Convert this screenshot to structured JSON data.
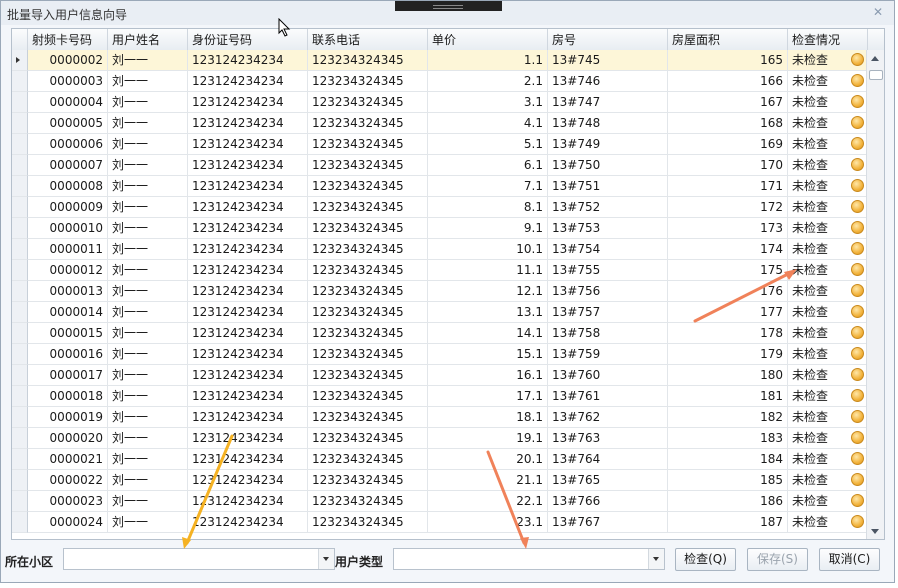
{
  "window": {
    "title": "批量导入用户信息向导"
  },
  "columns": [
    "射频卡号码",
    "用户姓名",
    "身份证号码",
    "联系电话",
    "单价",
    "房号",
    "房屋面积",
    "检查情况"
  ],
  "rows": [
    {
      "card": "0000002",
      "name": "刘一一",
      "id": "123124234234",
      "phone": "123234324345",
      "price": "1.1",
      "room": "13#745",
      "area": "165",
      "status": "未检查"
    },
    {
      "card": "0000003",
      "name": "刘一一",
      "id": "123124234234",
      "phone": "123234324345",
      "price": "2.1",
      "room": "13#746",
      "area": "166",
      "status": "未检查"
    },
    {
      "card": "0000004",
      "name": "刘一一",
      "id": "123124234234",
      "phone": "123234324345",
      "price": "3.1",
      "room": "13#747",
      "area": "167",
      "status": "未检查"
    },
    {
      "card": "0000005",
      "name": "刘一一",
      "id": "123124234234",
      "phone": "123234324345",
      "price": "4.1",
      "room": "13#748",
      "area": "168",
      "status": "未检查"
    },
    {
      "card": "0000006",
      "name": "刘一一",
      "id": "123124234234",
      "phone": "123234324345",
      "price": "5.1",
      "room": "13#749",
      "area": "169",
      "status": "未检查"
    },
    {
      "card": "0000007",
      "name": "刘一一",
      "id": "123124234234",
      "phone": "123234324345",
      "price": "6.1",
      "room": "13#750",
      "area": "170",
      "status": "未检查"
    },
    {
      "card": "0000008",
      "name": "刘一一",
      "id": "123124234234",
      "phone": "123234324345",
      "price": "7.1",
      "room": "13#751",
      "area": "171",
      "status": "未检查"
    },
    {
      "card": "0000009",
      "name": "刘一一",
      "id": "123124234234",
      "phone": "123234324345",
      "price": "8.1",
      "room": "13#752",
      "area": "172",
      "status": "未检查"
    },
    {
      "card": "0000010",
      "name": "刘一一",
      "id": "123124234234",
      "phone": "123234324345",
      "price": "9.1",
      "room": "13#753",
      "area": "173",
      "status": "未检查"
    },
    {
      "card": "0000011",
      "name": "刘一一",
      "id": "123124234234",
      "phone": "123234324345",
      "price": "10.1",
      "room": "13#754",
      "area": "174",
      "status": "未检查"
    },
    {
      "card": "0000012",
      "name": "刘一一",
      "id": "123124234234",
      "phone": "123234324345",
      "price": "11.1",
      "room": "13#755",
      "area": "175",
      "status": "未检查"
    },
    {
      "card": "0000013",
      "name": "刘一一",
      "id": "123124234234",
      "phone": "123234324345",
      "price": "12.1",
      "room": "13#756",
      "area": "176",
      "status": "未检查"
    },
    {
      "card": "0000014",
      "name": "刘一一",
      "id": "123124234234",
      "phone": "123234324345",
      "price": "13.1",
      "room": "13#757",
      "area": "177",
      "status": "未检查"
    },
    {
      "card": "0000015",
      "name": "刘一一",
      "id": "123124234234",
      "phone": "123234324345",
      "price": "14.1",
      "room": "13#758",
      "area": "178",
      "status": "未检查"
    },
    {
      "card": "0000016",
      "name": "刘一一",
      "id": "123124234234",
      "phone": "123234324345",
      "price": "15.1",
      "room": "13#759",
      "area": "179",
      "status": "未检查"
    },
    {
      "card": "0000017",
      "name": "刘一一",
      "id": "123124234234",
      "phone": "123234324345",
      "price": "16.1",
      "room": "13#760",
      "area": "180",
      "status": "未检查"
    },
    {
      "card": "0000018",
      "name": "刘一一",
      "id": "123124234234",
      "phone": "123234324345",
      "price": "17.1",
      "room": "13#761",
      "area": "181",
      "status": "未检查"
    },
    {
      "card": "0000019",
      "name": "刘一一",
      "id": "123124234234",
      "phone": "123234324345",
      "price": "18.1",
      "room": "13#762",
      "area": "182",
      "status": "未检查"
    },
    {
      "card": "0000020",
      "name": "刘一一",
      "id": "123124234234",
      "phone": "123234324345",
      "price": "19.1",
      "room": "13#763",
      "area": "183",
      "status": "未检查"
    },
    {
      "card": "0000021",
      "name": "刘一一",
      "id": "123124234234",
      "phone": "123234324345",
      "price": "20.1",
      "room": "13#764",
      "area": "184",
      "status": "未检查"
    },
    {
      "card": "0000022",
      "name": "刘一一",
      "id": "123124234234",
      "phone": "123234324345",
      "price": "21.1",
      "room": "13#765",
      "area": "185",
      "status": "未检查"
    },
    {
      "card": "0000023",
      "name": "刘一一",
      "id": "123124234234",
      "phone": "123234324345",
      "price": "22.1",
      "room": "13#766",
      "area": "186",
      "status": "未检查"
    },
    {
      "card": "0000024",
      "name": "刘一一",
      "id": "123124234234",
      "phone": "123234324345",
      "price": "23.1",
      "room": "13#767",
      "area": "187",
      "status": "未检查"
    }
  ],
  "bottom": {
    "community_label": "所在小区",
    "community_value": "",
    "usertype_label": "用户类型",
    "usertype_value": "",
    "check_button": "检查(Q)",
    "save_button": "保存(S)",
    "cancel_button": "取消(C)"
  },
  "colors": {
    "accent_arrow_orange": "#f0825a",
    "accent_arrow_yellow": "#f5b223",
    "status_dot": "#f2b33c",
    "selected_row": "#fdf6d8"
  }
}
